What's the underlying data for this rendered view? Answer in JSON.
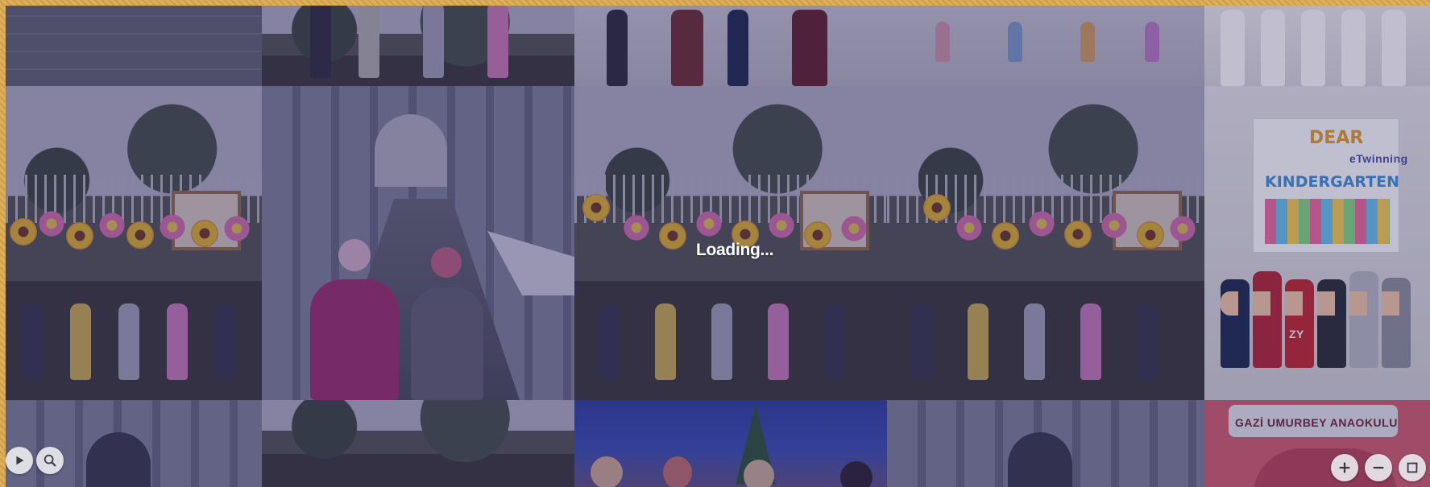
{
  "viewer": {
    "status_text": "Loading...",
    "controls": {
      "play_icon": "play-icon",
      "search_icon": "search-icon",
      "zoom_in_icon": "plus-icon",
      "zoom_out_icon": "minus-icon",
      "fullscreen_icon": "fullscreen-icon"
    }
  },
  "photos": {
    "poster": {
      "line1": "DEAR",
      "brand": "eTwinning",
      "line2": "KINDERGARTEN"
    },
    "school_banner": {
      "line1": "GAZİ UMURBEY ANAOKULU"
    },
    "shirt_text": "ZY"
  },
  "colors": {
    "frame": "#deae58",
    "overlay": "#28245f",
    "control_bg": "#ebebf0",
    "control_icon": "#3a3a40"
  }
}
